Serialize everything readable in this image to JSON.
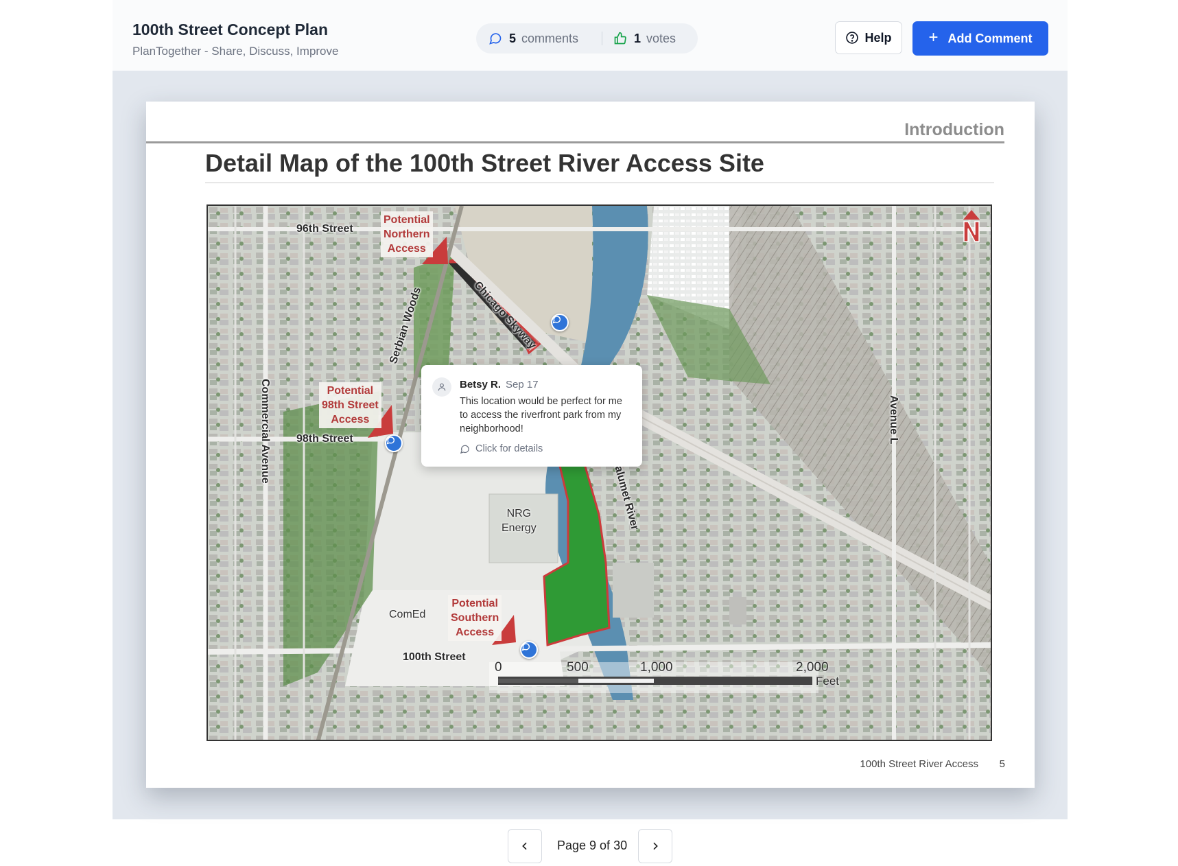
{
  "header": {
    "title": "100th Street Concept Plan",
    "subtitle": "PlanTogether - Share, Discuss, Improve",
    "comments_count": "5",
    "comments_label": "comments",
    "votes_count": "1",
    "votes_label": "votes",
    "help_label": "Help",
    "add_comment_label": "Add Comment",
    "accent_color": "#2563eb"
  },
  "page": {
    "section": "Introduction",
    "heading": "Detail Map of the 100th Street River Access Site",
    "footer_text": "100th Street River Access",
    "page_number": "5"
  },
  "map": {
    "streets": {
      "s96": "96th Street",
      "s98": "98th Street",
      "s100": "100th Street",
      "commercial": "Commercial Avenue",
      "serbian": "Serbian Woods",
      "skyway": "Chicago Skyway",
      "calumet": "Calumet River",
      "avenue_l": "Avenue L"
    },
    "callouts": {
      "northern": [
        "Potential",
        "Northern",
        "Access"
      ],
      "st98": [
        "Potential",
        "98th Street",
        "Access"
      ],
      "southern": [
        "Potential",
        "Southern",
        "Access"
      ]
    },
    "places": {
      "nrg": [
        "NRG",
        "Energy"
      ],
      "comed": "ComEd"
    },
    "scale": {
      "t0": "0",
      "t500": "500",
      "t1000": "1,000",
      "t2000": "2,000",
      "unit": "Feet"
    },
    "north": "N"
  },
  "comment": {
    "author": "Betsy R.",
    "date": "Sep 17",
    "text": "This location would be perfect for me to access the riverfront park from my neighborhood!",
    "details_label": "Click for details"
  },
  "pager": {
    "text": "Page 9 of 30"
  }
}
